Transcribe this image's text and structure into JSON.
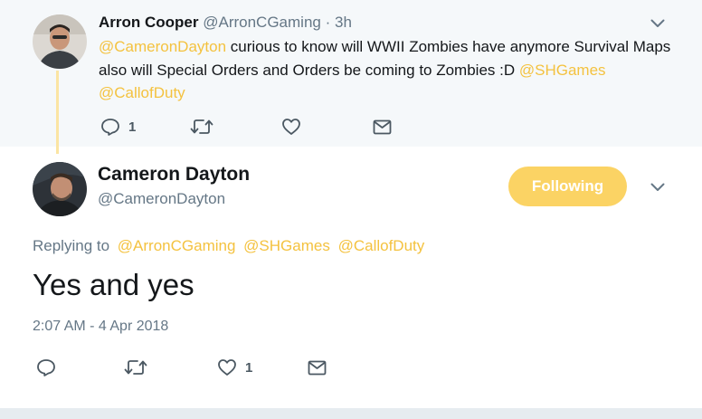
{
  "parent_tweet": {
    "author_name": "Arron Cooper",
    "author_handle": "@ArronCGaming",
    "separator": "·",
    "time": "3h",
    "text_segments": [
      {
        "text": "@CameronDayton",
        "mention": true
      },
      {
        "text": " curious to know will WWII Zombies have anymore Survival Maps also will Special Orders and Orders be coming to Zombies :D ",
        "mention": false
      },
      {
        "text": "@SHGames",
        "mention": true
      },
      {
        "text": " ",
        "mention": false
      },
      {
        "text": "@CallofDuty",
        "mention": true
      }
    ],
    "actions": {
      "reply_count": "1",
      "retweet_count": "",
      "like_count": ""
    }
  },
  "main_tweet": {
    "author_name": "Cameron Dayton",
    "author_handle": "@CameronDayton",
    "follow_button_label": "Following",
    "replying_prefix": "Replying to",
    "replying_to": [
      "@ArronCGaming",
      "@SHGames",
      "@CallofDuty"
    ],
    "text": "Yes and yes",
    "timestamp": "2:07 AM - 4 Apr 2018",
    "actions": {
      "reply_count": "",
      "retweet_count": "",
      "like_count": "1"
    }
  },
  "colors": {
    "accent": "#f4c23f",
    "follow_button_bg": "#fbd364",
    "muted_text": "#657786",
    "parent_bg": "#f5f8fa",
    "thread_line": "#fbe5a3"
  },
  "icons": [
    "chevron-down-icon",
    "reply-icon",
    "retweet-icon",
    "like-icon",
    "dm-icon",
    "avatar"
  ]
}
